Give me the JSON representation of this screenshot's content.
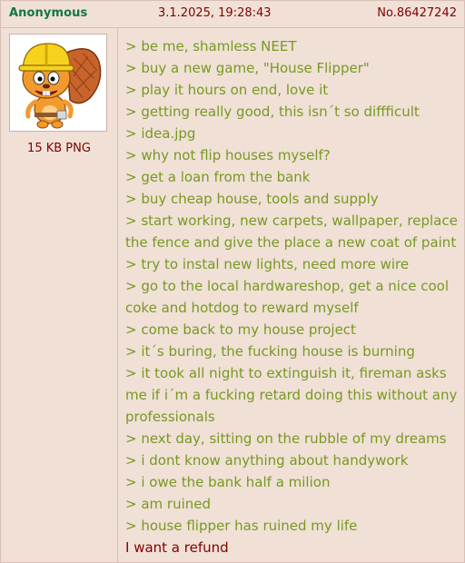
{
  "header": {
    "name": "Anonymous",
    "date": "3.1.2025, 19:28:43",
    "post_number": "No.86427242"
  },
  "file": {
    "info": "15 KB PNG",
    "thumbnail_icon": "cartoon-beaver-hardhat-icon"
  },
  "post": {
    "lines": [
      "> be me, shamless NEET",
      "> buy a new game, \"House Flipper\"",
      "> play it hours on end, love it",
      "> getting really good, this isn´t so diffficult",
      "> idea.jpg",
      "> why not flip houses myself?",
      "> get a loan from the bank",
      "> buy cheap house, tools and supply",
      "> start working, new carpets, wallpaper, replace the fence and give the place a new coat of paint",
      "> try to instal new lights, need more wire",
      "> go to the local hardwareshop, get a nice cool coke and hotdog to reward myself",
      "> come back to my house project",
      "> it´s buring, the fucking house is burning",
      "> it took all night to extinguish it, fireman asks me if i´m a fucking retard doing this without any professionals",
      "> next day, sitting on the rubble of my dreams",
      "> i dont know anything about handywork",
      "> i owe the bank half a milion",
      "> am ruined",
      "> house flipper has ruined my life"
    ],
    "closing": "I want a refund"
  },
  "colors": {
    "background": "#f0e0d6",
    "name": "#117743",
    "greentext": "#789922",
    "text": "#800000"
  }
}
